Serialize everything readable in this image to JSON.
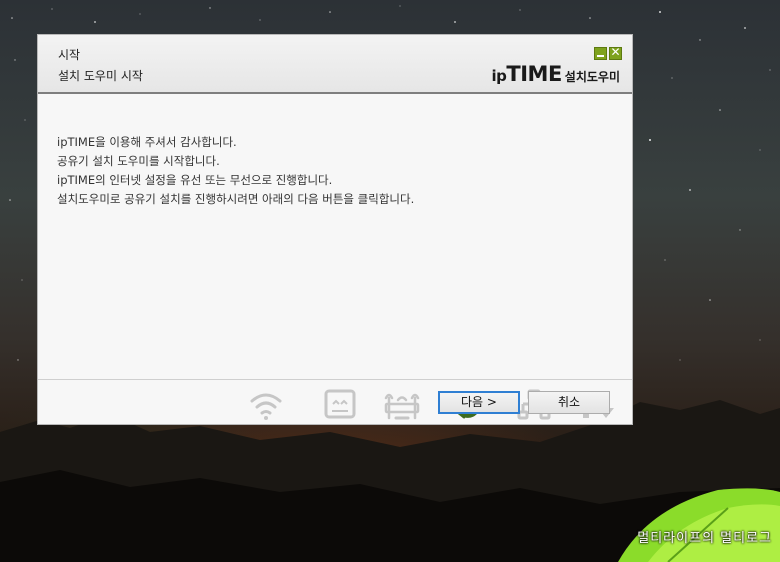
{
  "dialog": {
    "title": "시작",
    "subtitle": "설치 도우미 시작",
    "brand": {
      "logo_prefix": "ip",
      "logo_main": "TIME",
      "label": "설치도우미"
    },
    "window_buttons": {
      "close_glyph": "✕"
    },
    "message_lines": [
      "ipTIME을 이용해 주셔서 감사합니다.",
      "공유기 설치 도우미를 시작합니다.",
      "ipTIME의 인터넷 설정을 유선 또는 무선으로 진행합니다.",
      "설치도우미로 공유기 설치를 진행하시려면 아래의 다음 버튼을 클릭합니다."
    ],
    "steps": [
      {
        "icon": "wifi-icon",
        "active": false
      },
      {
        "icon": "modem-icon",
        "active": false
      },
      {
        "icon": "router-icon",
        "active": false
      },
      {
        "icon": "refresh-icon",
        "active": true
      },
      {
        "icon": "network-connect-icon",
        "active": false
      },
      {
        "icon": "transfer-arrows-icon",
        "active": false
      }
    ],
    "buttons": {
      "next": "다음 >",
      "cancel": "취소"
    },
    "colors": {
      "accent": "#7ea21d",
      "active_step": "#3d6b1f",
      "focus_border": "#2f7fd3"
    }
  },
  "watermark": "멀티라이프의 멀티로그"
}
